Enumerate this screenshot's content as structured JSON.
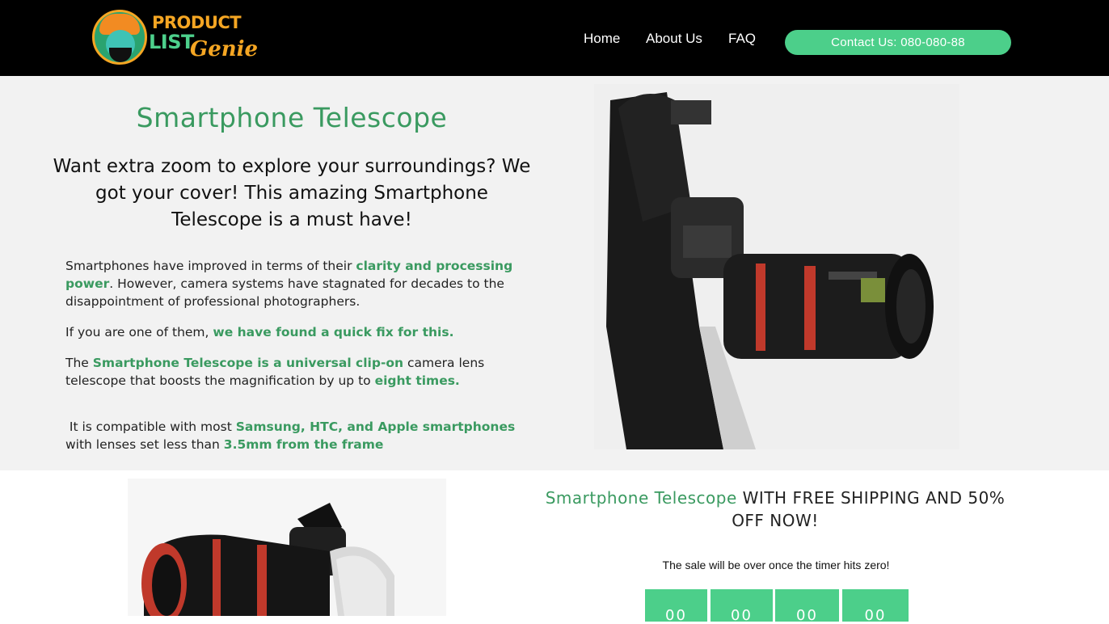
{
  "header": {
    "logo": {
      "line1": "PRODUCT",
      "line2": "LIST",
      "line3": "Genie",
      "icon": "genie-mascot-icon"
    },
    "nav": [
      {
        "label": "Home"
      },
      {
        "label": "About Us"
      },
      {
        "label": "FAQ"
      }
    ],
    "contact_label": "Contact Us: 080-080-88"
  },
  "hero": {
    "title": "Smartphone Telescope",
    "subtitle": "Want extra zoom to explore your surroundings? We got your cover! This amazing Smartphone Telescope is a must have!",
    "p1": {
      "text_a": "Smartphones have improved in terms of their ",
      "hl_a": "clarity and processing power",
      "text_b": ". However, camera systems have stagnated for decades to the disappointment of professional photographers."
    },
    "p2": {
      "text_a": "If you are one of them, ",
      "hl_a": "we have found a quick fix for this."
    },
    "p3": {
      "text_a": "The ",
      "hl_a": "Smartphone Telescope is a universal clip-on",
      "text_b": " camera lens telescope that boosts the magnification by up to ",
      "hl_b": "eight times."
    },
    "p4": {
      "text_a": " It is compatible with most ",
      "hl_a": "Samsung, HTC, and Apple smartphones",
      "text_b": " with lenses set less than ",
      "hl_b": "3.5mm from the frame"
    }
  },
  "offer": {
    "product": "Smartphone Telescope",
    "rest": " WITH FREE SHIPPING AND 50% OFF NOW!",
    "sale_note": "The sale will be over once the timer hits zero!"
  },
  "timer": {
    "blocks": [
      "00",
      "00",
      "00",
      "00"
    ]
  },
  "colors": {
    "accent_green": "#3a9a60",
    "button_green": "#4ccf8a",
    "header_bg": "#000000",
    "hero_bg": "#f2f2f2"
  }
}
